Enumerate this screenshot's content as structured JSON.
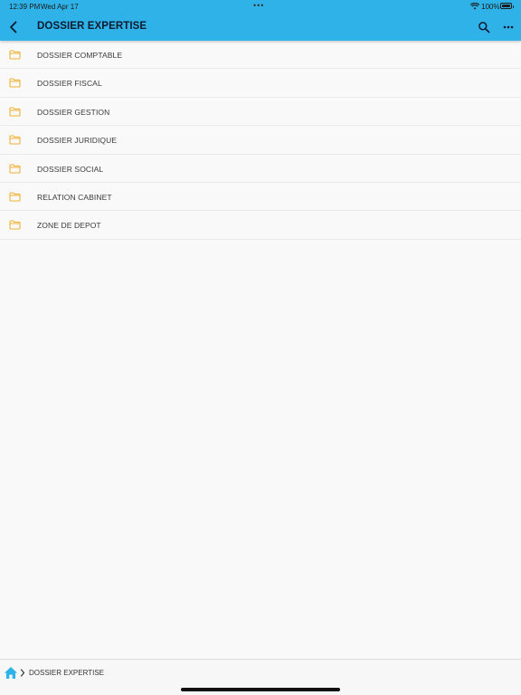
{
  "status_bar": {
    "time": "12:39 PM",
    "date": "Wed Apr 17",
    "multitask_dots": "•••",
    "battery_percent": "100%",
    "battery_level": 1.0
  },
  "header": {
    "title": "DOSSIER EXPERTISE",
    "back_icon": "chevron-left-icon",
    "search_icon": "search-icon",
    "more_icon": "more-horizontal-icon",
    "color": "#2fb2e8"
  },
  "folders": [
    {
      "label": "DOSSIER COMPTABLE",
      "icon": "folder-icon"
    },
    {
      "label": "DOSSIER FISCAL",
      "icon": "folder-icon"
    },
    {
      "label": "DOSSIER GESTION",
      "icon": "folder-icon"
    },
    {
      "label": "DOSSIER JURIDIQUE",
      "icon": "folder-icon"
    },
    {
      "label": "DOSSIER SOCIAL",
      "icon": "folder-icon"
    },
    {
      "label": "RELATION CABINET",
      "icon": "folder-icon"
    },
    {
      "label": "ZONE DE DEPOT",
      "icon": "folder-icon"
    }
  ],
  "folder_icon_color": "#f0b33c",
  "breadcrumb": {
    "home_icon": "home-icon",
    "separator_icon": "chevron-right-icon",
    "current": "DOSSIER EXPERTISE",
    "home_color": "#2fb2e8"
  }
}
